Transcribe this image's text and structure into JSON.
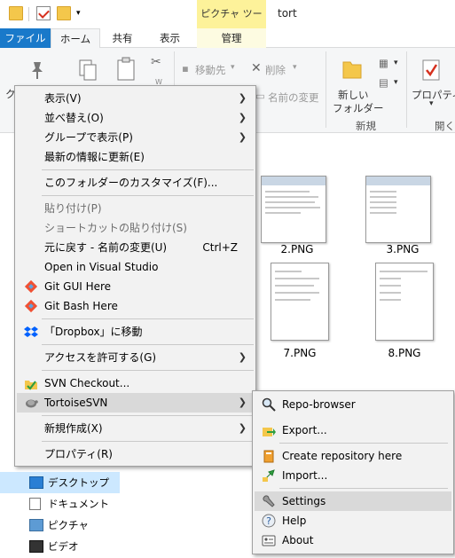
{
  "window": {
    "title": "tort",
    "contextual_tab_title": "ピクチャ ツール"
  },
  "tabs": {
    "file": "ファイル",
    "home": "ホーム",
    "share": "共有",
    "view": "表示",
    "manage": "管理"
  },
  "ribbon": {
    "move_to": "移動先",
    "delete": "削除",
    "rename": "名前の変更",
    "new_folder_line1": "新しい",
    "new_folder_line2": "フォルダー",
    "new_group": "新規",
    "properties": "プロパティ",
    "open_group": "開く",
    "truncated_label": "ク"
  },
  "files": [
    {
      "name": "2.PNG"
    },
    {
      "name": "3.PNG"
    },
    {
      "name": "7.PNG"
    },
    {
      "name": "8.PNG"
    }
  ],
  "nav": {
    "items": [
      {
        "label": "デスクトップ",
        "selected": true
      },
      {
        "label": "ドキュメント",
        "selected": false
      },
      {
        "label": "ピクチャ",
        "selected": false
      },
      {
        "label": "ビデオ",
        "selected": false
      }
    ]
  },
  "context_menu": {
    "items": [
      {
        "label": "表示(V)",
        "submenu": true
      },
      {
        "label": "並べ替え(O)",
        "submenu": true
      },
      {
        "label": "グループで表示(P)",
        "submenu": true
      },
      {
        "label": "最新の情報に更新(E)"
      },
      {
        "label": "このフォルダーのカスタマイズ(F)..."
      },
      {
        "label": "貼り付け(P)",
        "disabled": true
      },
      {
        "label": "ショートカットの貼り付け(S)",
        "disabled": true
      },
      {
        "label": "元に戻す - 名前の変更(U)",
        "shortcut": "Ctrl+Z"
      },
      {
        "label": "Open in Visual Studio"
      },
      {
        "label": "Git GUI Here",
        "icon": "git-icon"
      },
      {
        "label": "Git Bash Here",
        "icon": "git-icon"
      },
      {
        "label": "「Dropbox」に移動",
        "icon": "dropbox-icon"
      },
      {
        "label": "アクセスを許可する(G)",
        "submenu": true
      },
      {
        "label": "SVN Checkout...",
        "icon": "svn-checkout-icon"
      },
      {
        "label": "TortoiseSVN",
        "icon": "tortoisesvn-icon",
        "submenu": true,
        "highlighted": true
      },
      {
        "label": "新規作成(X)",
        "submenu": true
      },
      {
        "label": "プロパティ(R)"
      }
    ]
  },
  "submenu": {
    "items": [
      {
        "label": "Repo-browser",
        "icon": "repo-browser-icon"
      },
      {
        "label": "Export...",
        "icon": "export-icon"
      },
      {
        "label": "Create repository here",
        "icon": "create-repo-icon"
      },
      {
        "label": "Import...",
        "icon": "import-icon"
      },
      {
        "label": "Settings",
        "icon": "settings-icon",
        "highlighted": true
      },
      {
        "label": "Help",
        "icon": "help-icon"
      },
      {
        "label": "About",
        "icon": "about-icon"
      }
    ]
  },
  "colors": {
    "file_tab": "#1979ca",
    "contextual_tab": "#fdf29a",
    "menu_bg": "#f2f2f2",
    "menu_highlight": "#d9d9d9",
    "nav_selected": "#cce8ff"
  }
}
